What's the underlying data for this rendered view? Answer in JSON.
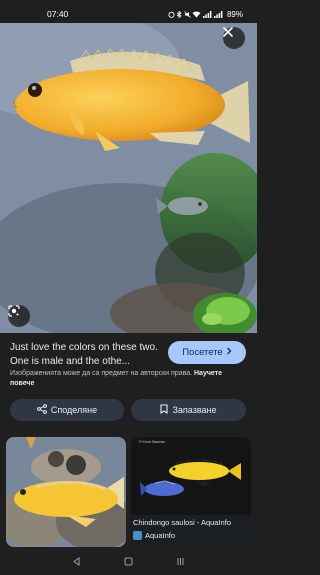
{
  "status_bar": {
    "time": "07:40",
    "battery": "89%"
  },
  "result": {
    "title": "Just love the colors on these two. One is male and the othe...",
    "visit_button": "Посетете",
    "notice_text": "Изображенията може да са предмет на авторски права.",
    "notice_link": "Научете повече"
  },
  "actions": {
    "share": "Споделяне",
    "save": "Запазване"
  },
  "related": [
    {
      "caption": "",
      "source": ""
    },
    {
      "caption": "Chindongo saulosi - AquaInfo",
      "source": "AquaInfo",
      "watermark": "© Kevin Bauman"
    }
  ],
  "icons": {
    "close": "close-icon",
    "lens": "google-lens-icon",
    "share": "share-icon",
    "save": "bookmark-icon",
    "chevron": "chevron-right-icon",
    "nav_back": "back-triangle-icon",
    "nav_home": "home-square-icon",
    "nav_recents": "recents-icon"
  },
  "colors": {
    "background": "#1f1f1f",
    "visit_button_bg": "#a8c7fa",
    "visit_button_text": "#062e6f",
    "action_button_bg": "#303744",
    "fish_yellow": "#f4b73a"
  }
}
